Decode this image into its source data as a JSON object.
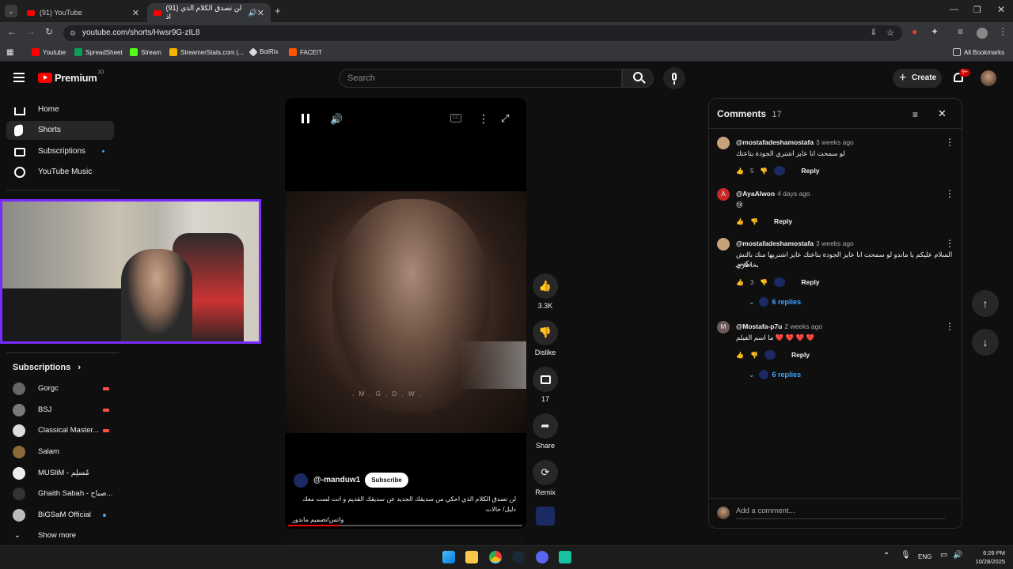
{
  "browser": {
    "tabs": [
      {
        "title": "(91) YouTube"
      },
      {
        "title": "(91) لن تصدق الكلام الذي اذ"
      }
    ],
    "url": "youtube.com/shorts/Hwsr9G-zIL8",
    "bookmarks": [
      "Youtube",
      "SpreadSheet",
      "Stream",
      "StreamerStats.com |...",
      "BotRix",
      "FACEIT"
    ],
    "all_bookmarks": "All Bookmarks"
  },
  "header": {
    "logo": "Premium",
    "logo_sup": "JO",
    "search_placeholder": "Search",
    "create_label": "Create",
    "notif_badge": "9+"
  },
  "sidebar": {
    "items": [
      {
        "label": "Home"
      },
      {
        "label": "Shorts"
      },
      {
        "label": "Subscriptions"
      },
      {
        "label": "YouTube Music"
      }
    ],
    "subscriptions_title": "Subscriptions",
    "subscriptions": [
      {
        "name": "Gorgc"
      },
      {
        "name": "BSJ"
      },
      {
        "name": "Classical Master..."
      },
      {
        "name": "Salam"
      },
      {
        "name": "MUSliM - مُسلِم"
      },
      {
        "name": "Ghaith Sabah - صباح..."
      },
      {
        "name": "BiGSaM Official"
      }
    ],
    "show_more": "Show more"
  },
  "player": {
    "watermark": ". M . G . D . W .",
    "channel": "@-manduw1",
    "subscribe": "Subscribe",
    "caption_line1": "لن تصدق الكلام الذي احكي من سديقك الجديد عن سديقك القديم و انت لست معك دليل/ حالات",
    "caption_line2": "واتس/تصميم ماندور"
  },
  "actions": {
    "likes": "3.3K",
    "dislike": "Dislike",
    "comments": "17",
    "share": "Share",
    "remix": "Remix"
  },
  "comments": {
    "title": "Comments",
    "count": "17",
    "items": [
      {
        "author": "@mostafadeshamostafa",
        "time": "3 weeks ago",
        "text": "لو سمحت انا عايز اشتري الجودة بتاعتك",
        "likes": "5",
        "reply": "Reply"
      },
      {
        "author": "@AyaAlwon",
        "time": "4 days ago",
        "text": "😢",
        "likes": "",
        "reply": "Reply"
      },
      {
        "author": "@mostafadeshamostafa",
        "time": "3 weeks ago",
        "text": "السلام عليكم يا ماندو لو سمحت انا عايز الجودة بتاعتك عايز اشتريها منك بالتش تكسر",
        "text2": "بخاطري",
        "likes": "3",
        "reply": "Reply",
        "replies": "6 replies"
      },
      {
        "author": "@Mostafa-p7u",
        "time": "2 weeks ago",
        "text": "ما اسم الفيلم ❤️ ❤️ ❤️ ❤️",
        "likes": "",
        "reply": "Reply",
        "replies": "6 replies"
      }
    ],
    "add_placeholder": "Add a comment..."
  },
  "taskbar": {
    "lang": "ENG",
    "time": "6:26 PM",
    "date": "10/28/2025"
  }
}
